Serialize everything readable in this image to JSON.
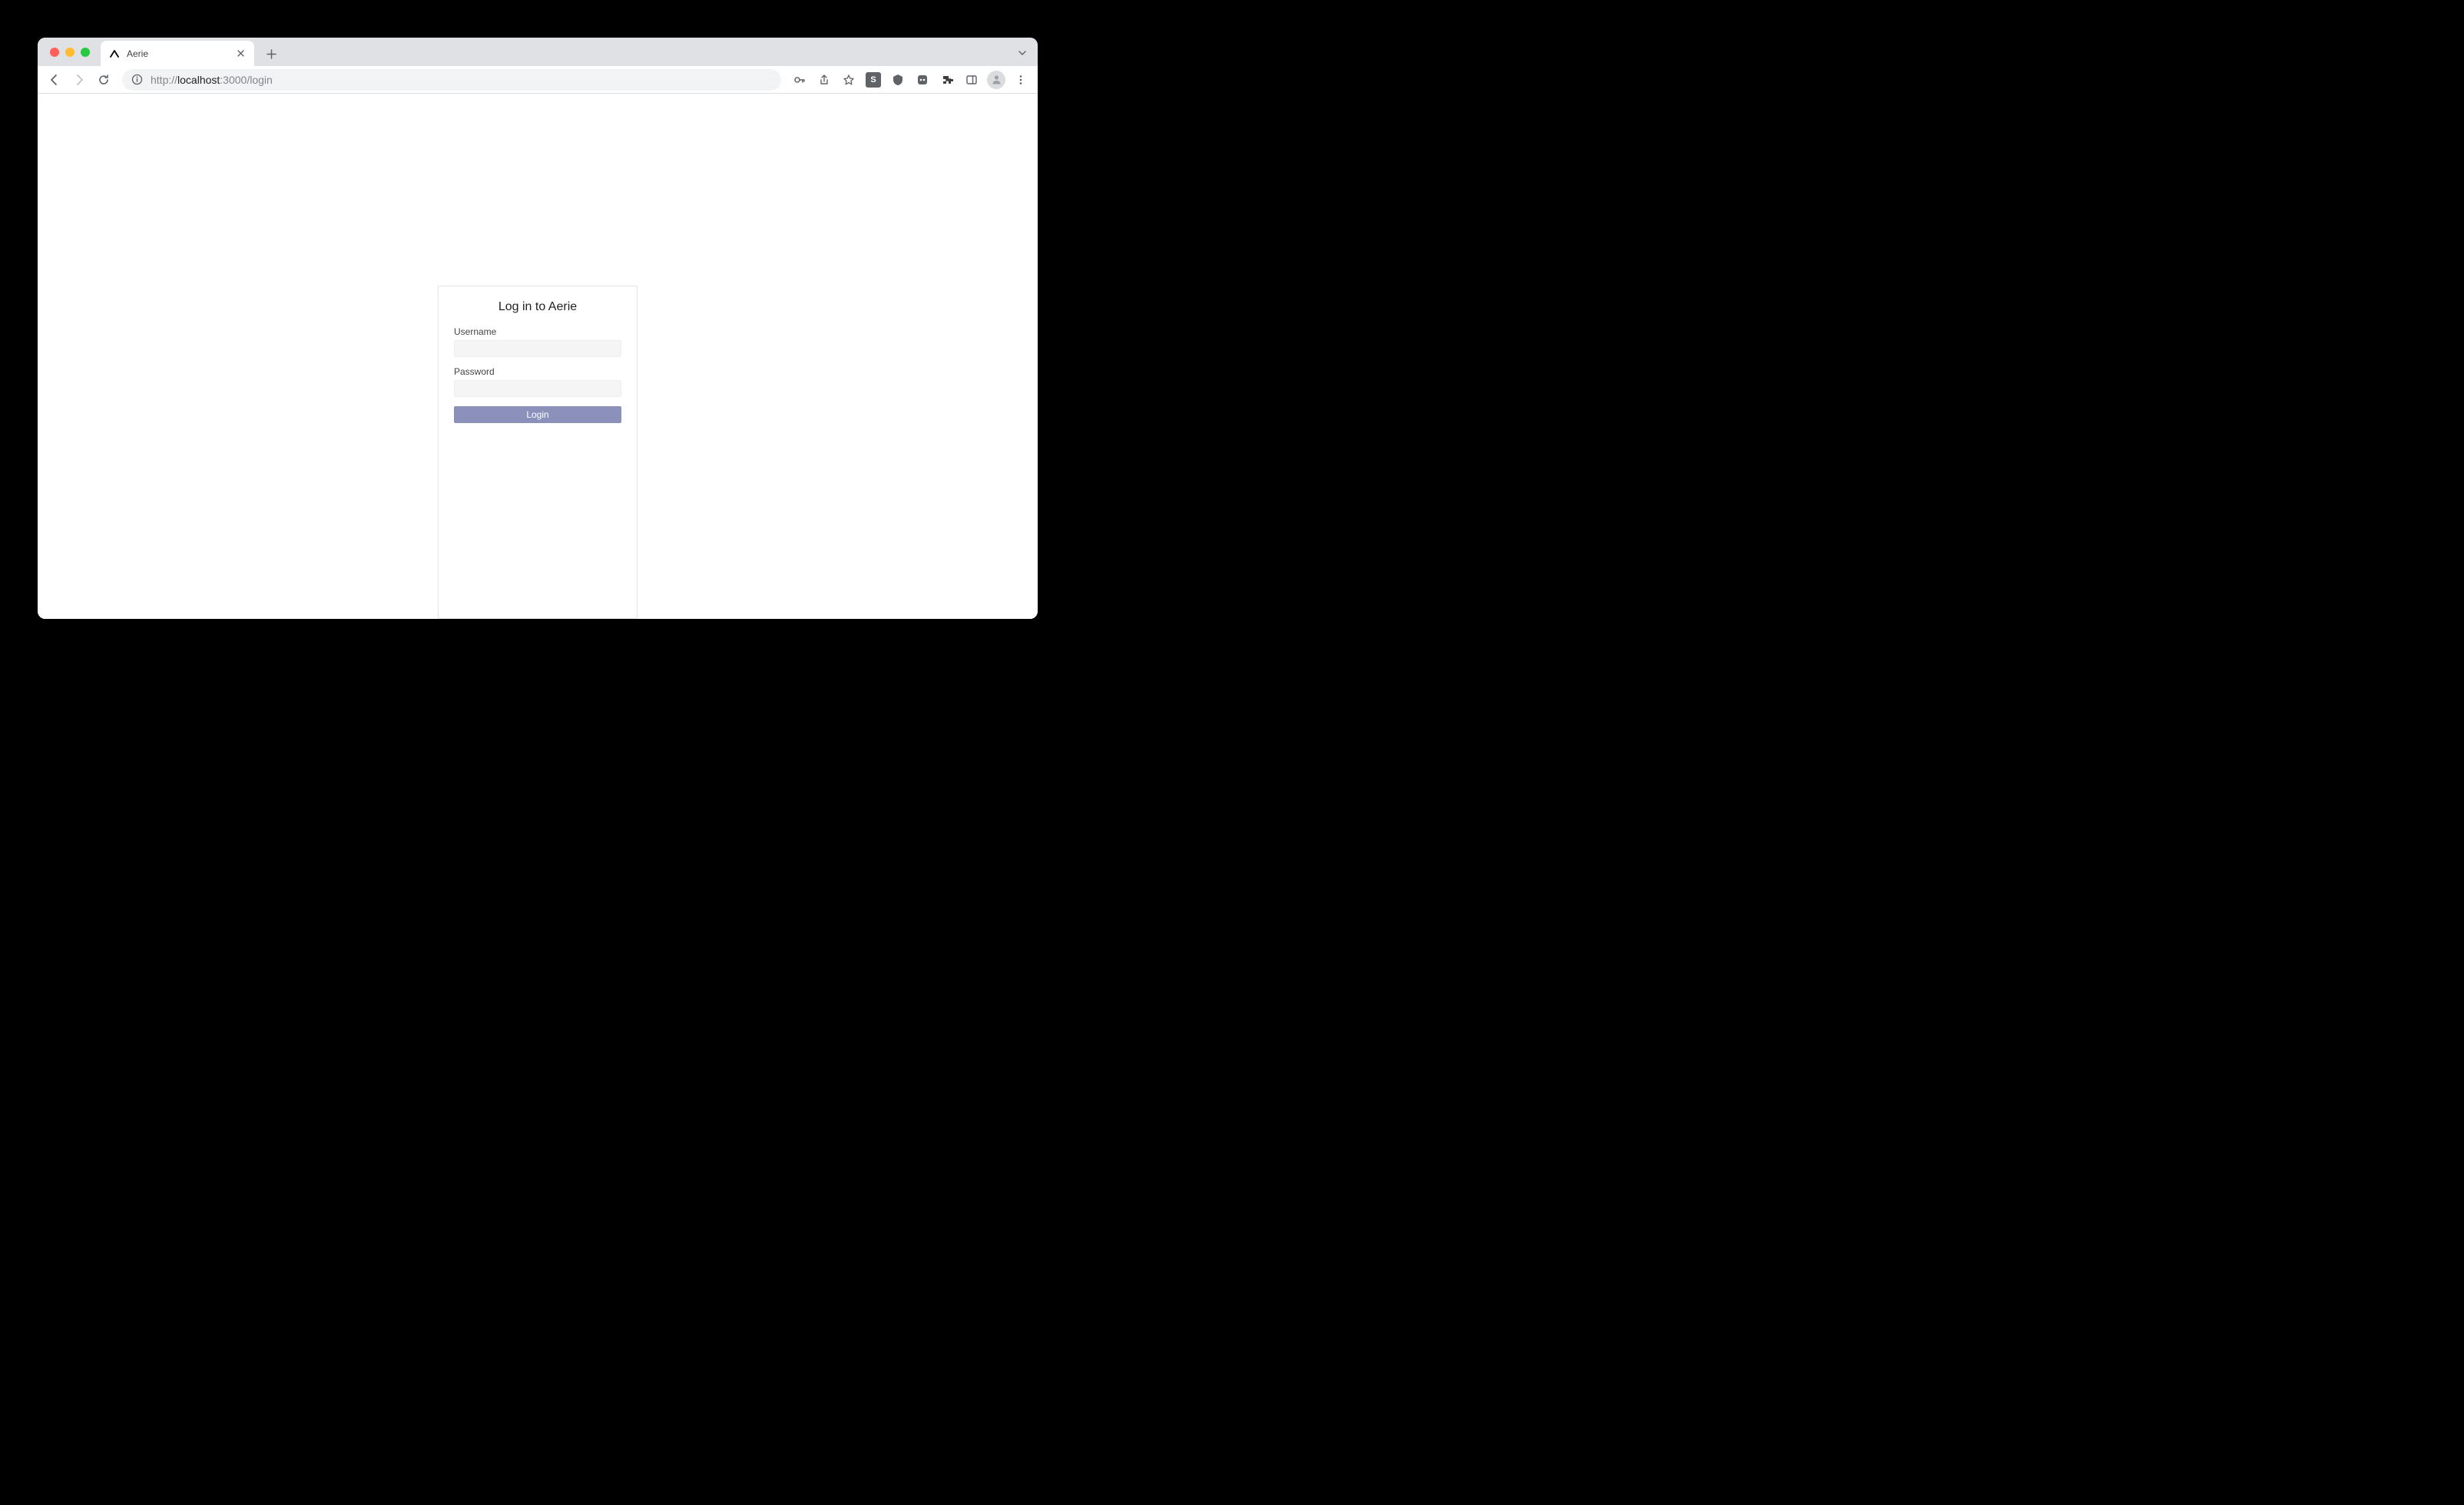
{
  "browser": {
    "tab_title": "Aerie",
    "url_prefix": "http://",
    "url_host": "localhost",
    "url_port_path": ":3000/login"
  },
  "login": {
    "title": "Log in to Aerie",
    "username_label": "Username",
    "username_value": "",
    "password_label": "Password",
    "password_value": "",
    "button_label": "Login"
  }
}
